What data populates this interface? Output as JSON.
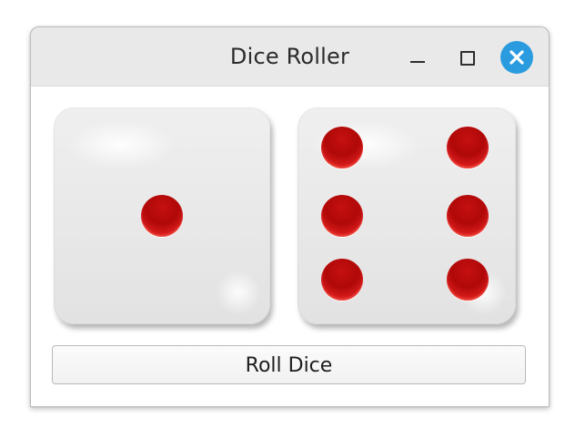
{
  "window": {
    "title": "Dice Roller"
  },
  "titlebar": {
    "buttons": [
      "minimize-icon",
      "maximize-icon",
      "close-icon"
    ],
    "close_color": "#2b9be0"
  },
  "dice": [
    {
      "value": 1
    },
    {
      "value": 6
    }
  ],
  "pip_color": "#c51010",
  "roll_button": {
    "label": "Roll Dice"
  }
}
